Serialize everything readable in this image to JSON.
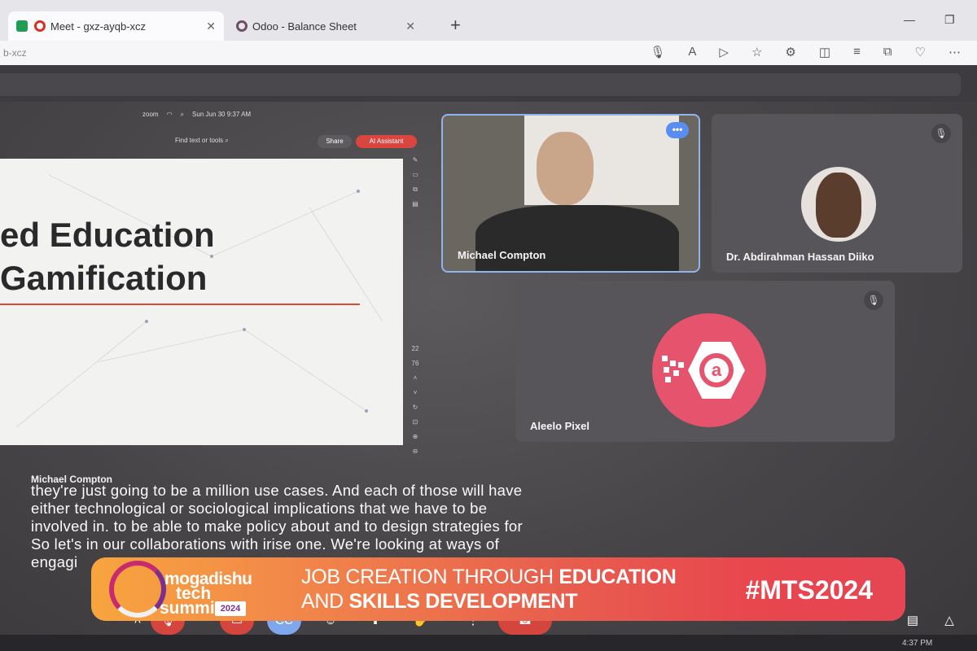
{
  "browser": {
    "tabs": [
      {
        "label": "Meet - gxz-ayqb-xcz",
        "active": true
      },
      {
        "label": "Odoo - Balance Sheet",
        "active": false
      }
    ],
    "url_fragment": "b-xcz"
  },
  "shared_screen": {
    "zoom_label": "zoom",
    "clock": "Sun Jun 30  9:37 AM",
    "find_placeholder": "Find text or tools",
    "share_label": "Share",
    "ai_label": "AI Assistant",
    "slide_line1": "ed Education",
    "slide_line2": "Gamification",
    "page_current": "22",
    "page_total": "76"
  },
  "participants": [
    {
      "name": "Michael Compton",
      "muted": false,
      "speaking": true
    },
    {
      "name": "Dr. Abdirahman Hassan Diiko",
      "muted": true
    },
    {
      "name": "Aleelo Pixel",
      "muted": true
    }
  ],
  "captions": {
    "speaker": "Michael Compton",
    "lines": [
      "they're just going to be a million use cases. And each of those will have",
      "either technological or sociological implications that we have to be",
      "involved in. to be able to make policy about and to design strategies for",
      "So let's in our collaborations with irise one. We're looking at ways of",
      "engagi"
    ]
  },
  "banner": {
    "logo_line1": "mogadishu",
    "logo_line2": "tech",
    "logo_line3": "summit",
    "logo_year": "2024",
    "line1_normal1": "JOB CREATION",
    "line1_normal2": " THROUGH ",
    "line1_bold": "EDUCATION",
    "line2_normal": "AND ",
    "line2_bold": "SKILLS DEVELOPMENT",
    "hashtag": "#MTS2024"
  },
  "taskbar": {
    "time": "4:37 PM"
  },
  "colors": {
    "banner_start": "#f7a53e",
    "banner_end": "#e64553",
    "accent_red": "#d4453d",
    "speaking_border": "#8fb4ee"
  }
}
